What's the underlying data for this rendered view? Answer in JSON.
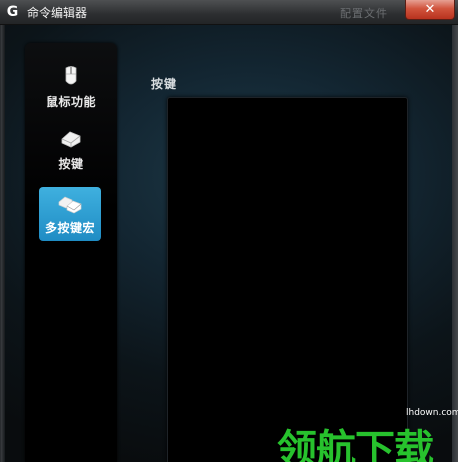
{
  "window": {
    "title": "命令编辑器",
    "logo": "G",
    "close_glyph": "✕",
    "title_ghost": "配置文件"
  },
  "sidebar": {
    "items": [
      {
        "label": "鼠标功能",
        "icon": "mouse-icon",
        "selected": false
      },
      {
        "label": "按键",
        "icon": "key-icon",
        "selected": false
      },
      {
        "label": "多按键宏",
        "icon": "multi-key-icon",
        "selected": true
      }
    ]
  },
  "content": {
    "section_label": "按键"
  },
  "watermark": {
    "url": "lhdown.com",
    "text": "领航下载"
  },
  "colors": {
    "accent": "#2a9fd6",
    "background": "#0f1418",
    "watermark": "#27c22d",
    "close_button": "#c9442f"
  }
}
